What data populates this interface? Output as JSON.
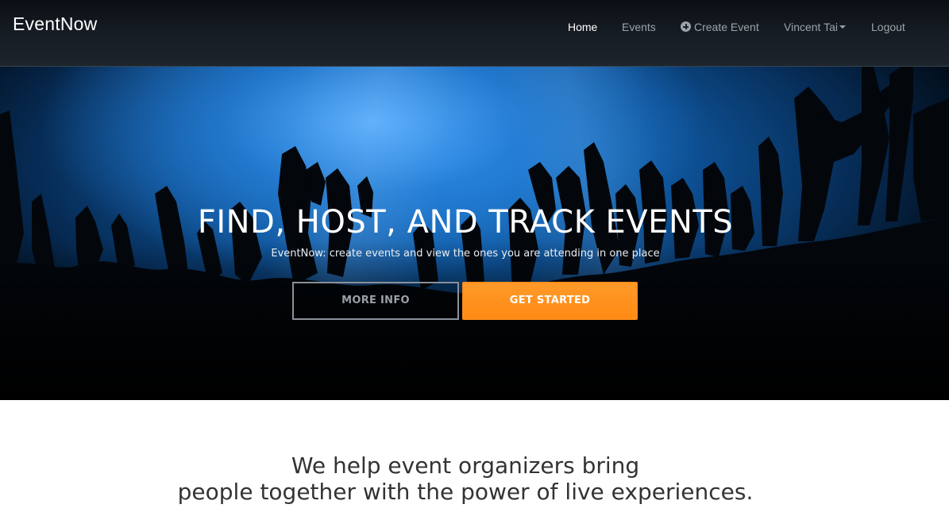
{
  "navbar": {
    "brand": "EventNow",
    "items": [
      {
        "label": "Home",
        "active": true
      },
      {
        "label": "Events",
        "active": false
      },
      {
        "label": "Create Event",
        "icon": "plus-circle-icon",
        "active": false
      },
      {
        "label": "Vincent Tai",
        "icon": "caret-down-icon",
        "active": false
      },
      {
        "label": "Logout",
        "active": false
      }
    ]
  },
  "hero": {
    "title": "FIND, HOST, AND TRACK EVENTS",
    "subtitle": "EventNow: create events and view the ones you are attending in one place",
    "more_info_label": "MORE INFO",
    "get_started_label": "GET STARTED"
  },
  "about": {
    "line1": "We help event organizers bring",
    "line2": "people together with the power of live experiences."
  },
  "colors": {
    "navbar_bg": "#151b22",
    "nav_text": "#9da3a9",
    "nav_active": "#ffffff",
    "accent_orange": "#ff8a12",
    "hero_blue": "#1c7fd6",
    "body_text": "#333333"
  }
}
